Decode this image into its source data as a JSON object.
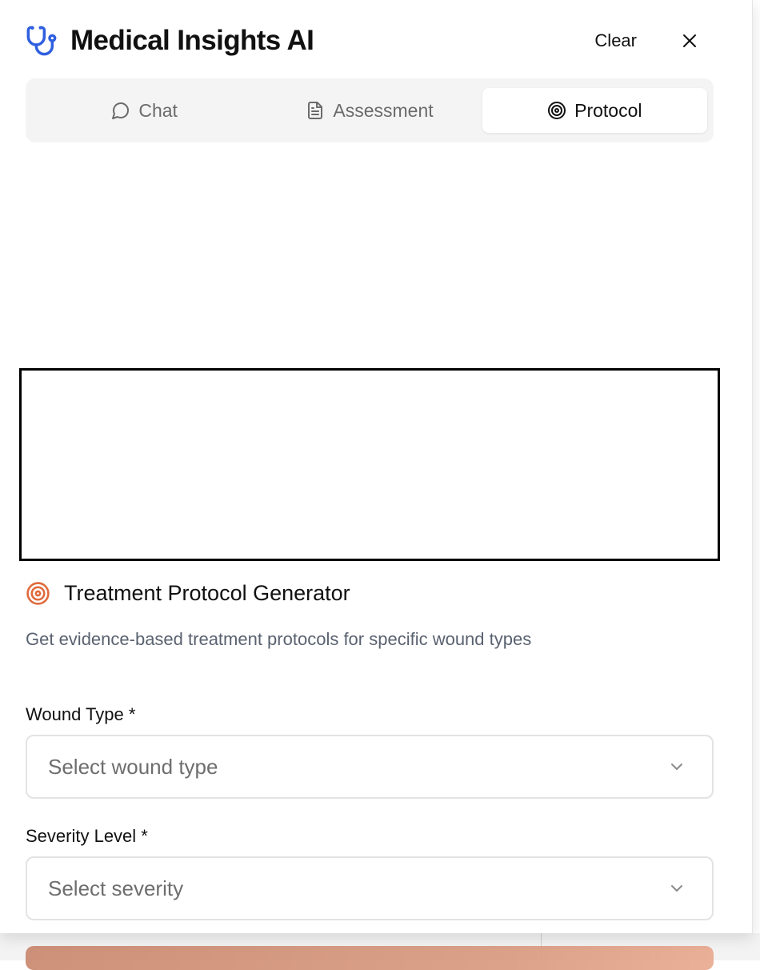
{
  "header": {
    "title": "Medical Insights AI",
    "clear_label": "Clear",
    "logo_icon": "stethoscope-icon",
    "close_icon": "close-icon"
  },
  "tabs": [
    {
      "label": "Chat",
      "icon": "message-circle-icon",
      "active": false
    },
    {
      "label": "Assessment",
      "icon": "file-text-icon",
      "active": false
    },
    {
      "label": "Protocol",
      "icon": "target-icon",
      "active": true
    }
  ],
  "section": {
    "title": "Treatment Protocol Generator",
    "description": "Get evidence-based treatment protocols for specific wound types",
    "icon": "target-icon"
  },
  "form": {
    "wound_type": {
      "label": "Wound Type *",
      "placeholder": "Select wound type"
    },
    "severity": {
      "label": "Severity Level *",
      "placeholder": "Select severity"
    }
  },
  "colors": {
    "accent_blue": "#2f5fe0",
    "accent_orange": "#e06a3c",
    "button_gradient": "#d8987d"
  }
}
